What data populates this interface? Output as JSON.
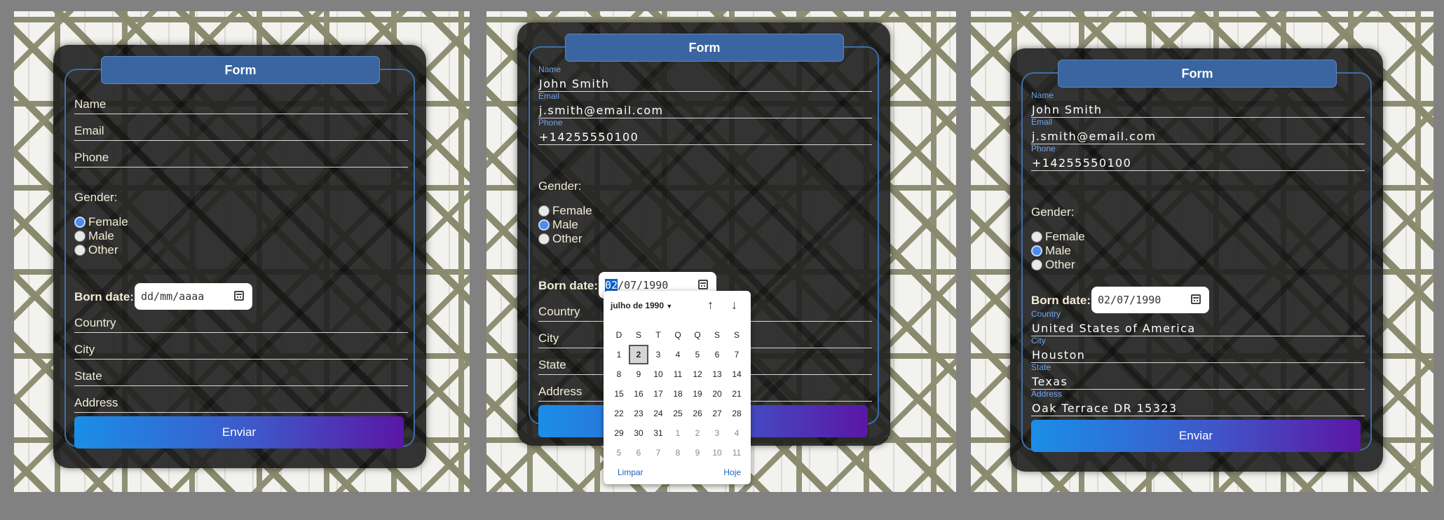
{
  "form_title": "Form",
  "fields": {
    "name": "Name",
    "email": "Email",
    "phone": "Phone",
    "country": "Country",
    "city": "City",
    "state": "State",
    "address": "Address"
  },
  "gender_label": "Gender:",
  "gender_options": [
    "Female",
    "Male",
    "Other"
  ],
  "born_label": "Born date:",
  "submit_label": "Enviar",
  "panel1": {
    "date_placeholder": "dd/mm/aaaa",
    "selected_gender": "Female"
  },
  "panel2": {
    "name": "John Smith",
    "email": "j.smith@email.com",
    "phone": "+14255550100",
    "selected_gender": "Male",
    "date_day": "02",
    "date_rest": "/07/1990",
    "picker": {
      "month_label": "julho de 1990",
      "weekdays": [
        "D",
        "S",
        "T",
        "Q",
        "Q",
        "S",
        "S"
      ],
      "days": [
        "1",
        "2",
        "3",
        "4",
        "5",
        "6",
        "7",
        "8",
        "9",
        "10",
        "11",
        "12",
        "13",
        "14",
        "15",
        "16",
        "17",
        "18",
        "19",
        "20",
        "21",
        "22",
        "23",
        "24",
        "25",
        "26",
        "27",
        "28",
        "29",
        "30",
        "31",
        "1",
        "2",
        "3",
        "4",
        "5",
        "6",
        "7",
        "8",
        "9",
        "10",
        "11"
      ],
      "selected_day": "2",
      "clear_label": "Limpar",
      "today_label": "Hoje"
    }
  },
  "panel3": {
    "name": "John Smith",
    "email": "j.smith@email.com",
    "phone": "+14255550100",
    "selected_gender": "Male",
    "date_value": "02/07/1990",
    "country": "United States of America",
    "city": "Houston",
    "state": "Texas",
    "address": "Oak Terrace DR 15323"
  },
  "icons": {
    "calendar": "calendar-icon",
    "dropdown": "caret-down-icon",
    "up": "arrow-up-icon",
    "down": "arrow-down-icon"
  }
}
